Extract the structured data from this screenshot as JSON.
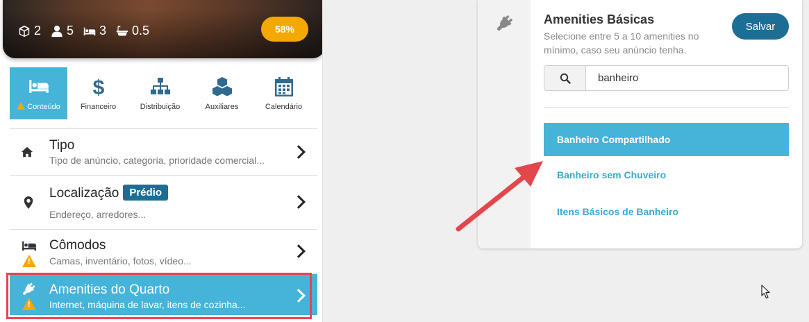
{
  "hero": {
    "stats": [
      {
        "icon": "cube-icon",
        "value": "2"
      },
      {
        "icon": "user-icon",
        "value": "5"
      },
      {
        "icon": "bed-icon",
        "value": "3"
      },
      {
        "icon": "bath-icon",
        "value": "0.5"
      }
    ],
    "progress": "58%"
  },
  "tabs": [
    {
      "label": "Conteúdo",
      "icon": "bed-icon",
      "active": true,
      "warning": true
    },
    {
      "label": "Financeiro",
      "icon": "dollar-icon"
    },
    {
      "label": "Distribuição",
      "icon": "sitemap-icon"
    },
    {
      "label": "Auxiliares",
      "icon": "cubes-icon"
    },
    {
      "label": "Calendário",
      "icon": "calendar-icon"
    }
  ],
  "menu": [
    {
      "title": "Tipo",
      "subtitle": "Tipo de anúncio, categoria, prioridade comercial...",
      "icon": "home-icon"
    },
    {
      "title": "Localização",
      "badge": "Prédio",
      "subtitle": "Endereço, arredores...",
      "icon": "map-marker-icon"
    },
    {
      "title": "Cômodos",
      "subtitle": "Camas, inventário, fotos, vídeo...",
      "icon": "bed-icon",
      "warning": true
    },
    {
      "title": "Amenities do Quarto",
      "subtitle": "Internet, máquina de lavar, itens de cozinha...",
      "icon": "plug-icon",
      "warning": true,
      "active": true
    }
  ],
  "panel": {
    "icon": "plug-icon",
    "title": "Amenities Básicas",
    "description": "Selecione entre 5 a 10 amenities no mínimo, caso seu anúncio tenha.",
    "save_label": "Salvar",
    "search_value": "banheiro",
    "results": [
      "Banheiro Compartilhado",
      "Banheiro sem Chuveiro",
      "Itens Básicos de Banheiro"
    ]
  },
  "colors": {
    "accent": "#46b3d9",
    "brand": "#1d6e95",
    "warning": "#f5a800",
    "annotation": "#e4474b"
  }
}
